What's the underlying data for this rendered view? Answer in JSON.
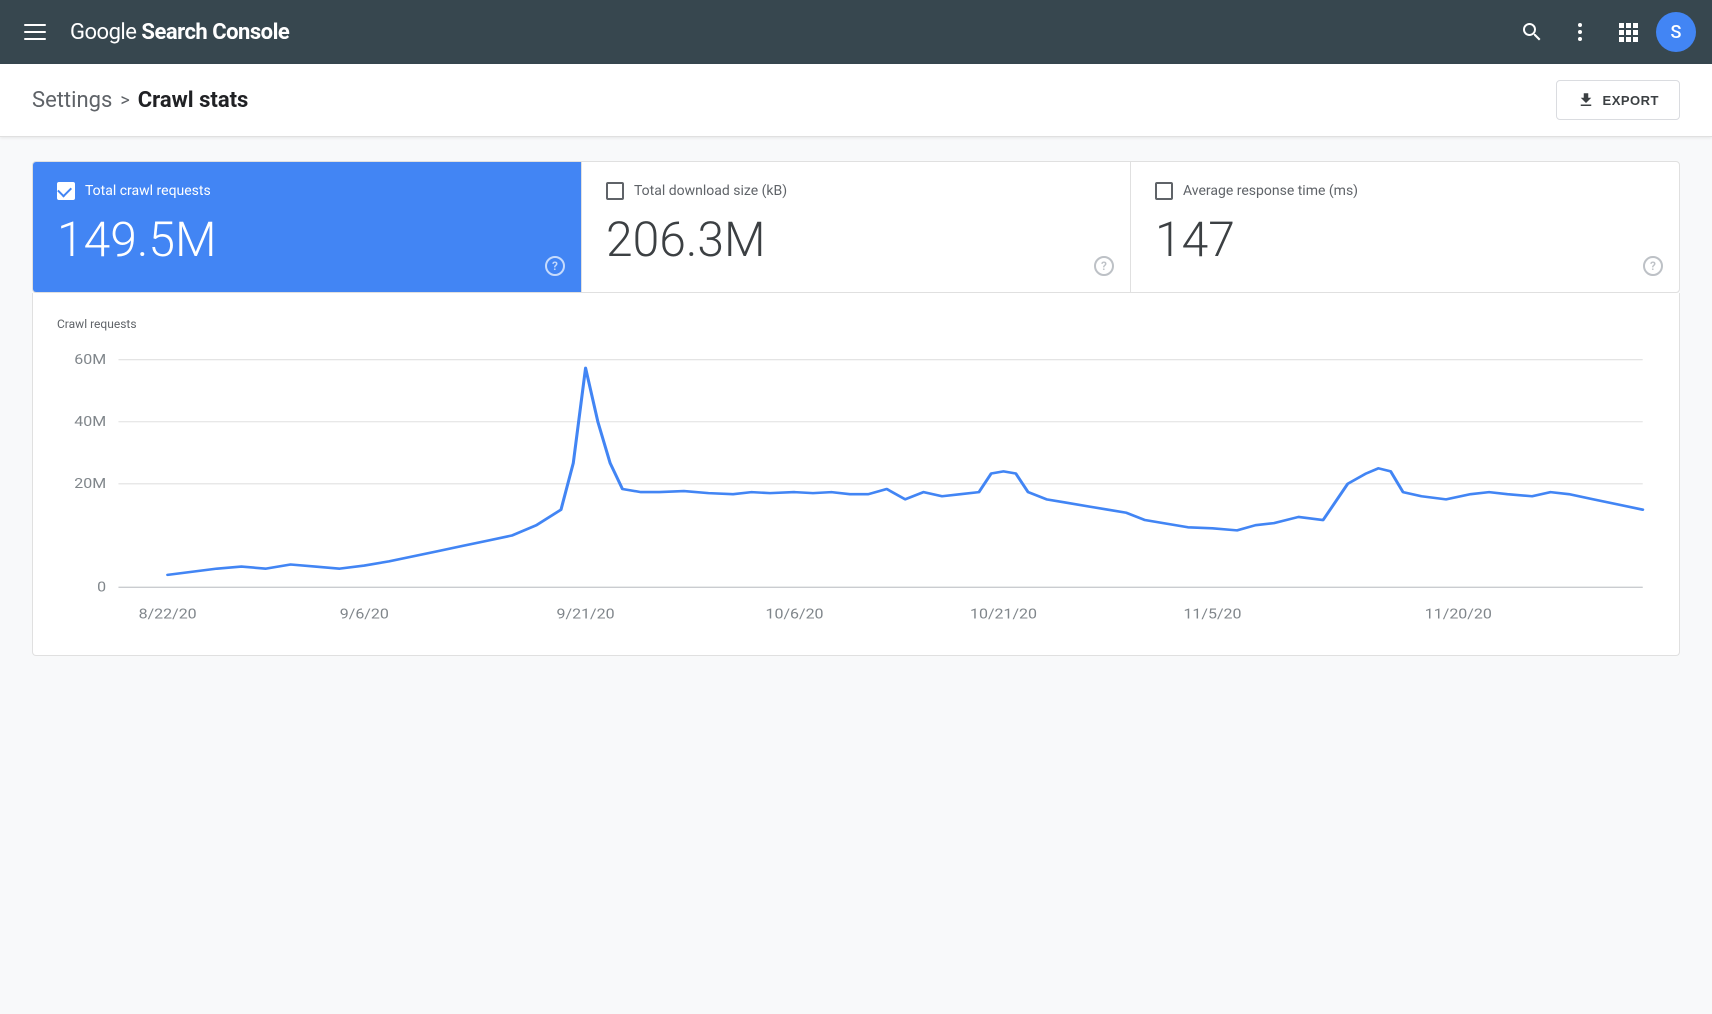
{
  "header": {
    "title_regular": "Google ",
    "title_bold": "Search Console",
    "avatar_letter": "S",
    "search_label": "Search",
    "more_options_label": "More options",
    "apps_label": "Google apps"
  },
  "breadcrumb": {
    "settings_label": "Settings",
    "separator": ">",
    "current_label": "Crawl stats"
  },
  "toolbar": {
    "export_label": "EXPORT"
  },
  "stats": [
    {
      "id": "total-crawl-requests",
      "label": "Total crawl requests",
      "value": "149.5M",
      "active": true
    },
    {
      "id": "total-download-size",
      "label": "Total download size (kB)",
      "value": "206.3M",
      "active": false
    },
    {
      "id": "average-response-time",
      "label": "Average response time (ms)",
      "value": "147",
      "active": false
    }
  ],
  "chart": {
    "y_label": "Crawl requests",
    "y_axis": [
      "60M",
      "40M",
      "20M",
      "0"
    ],
    "x_axis": [
      "8/22/20",
      "9/6/20",
      "9/21/20",
      "10/6/20",
      "10/21/20",
      "11/5/20",
      "11/20/20"
    ],
    "colors": {
      "active": "#4285f4",
      "line": "#4285f4",
      "grid": "#e0e0e0",
      "axis_text": "#80868b"
    }
  }
}
